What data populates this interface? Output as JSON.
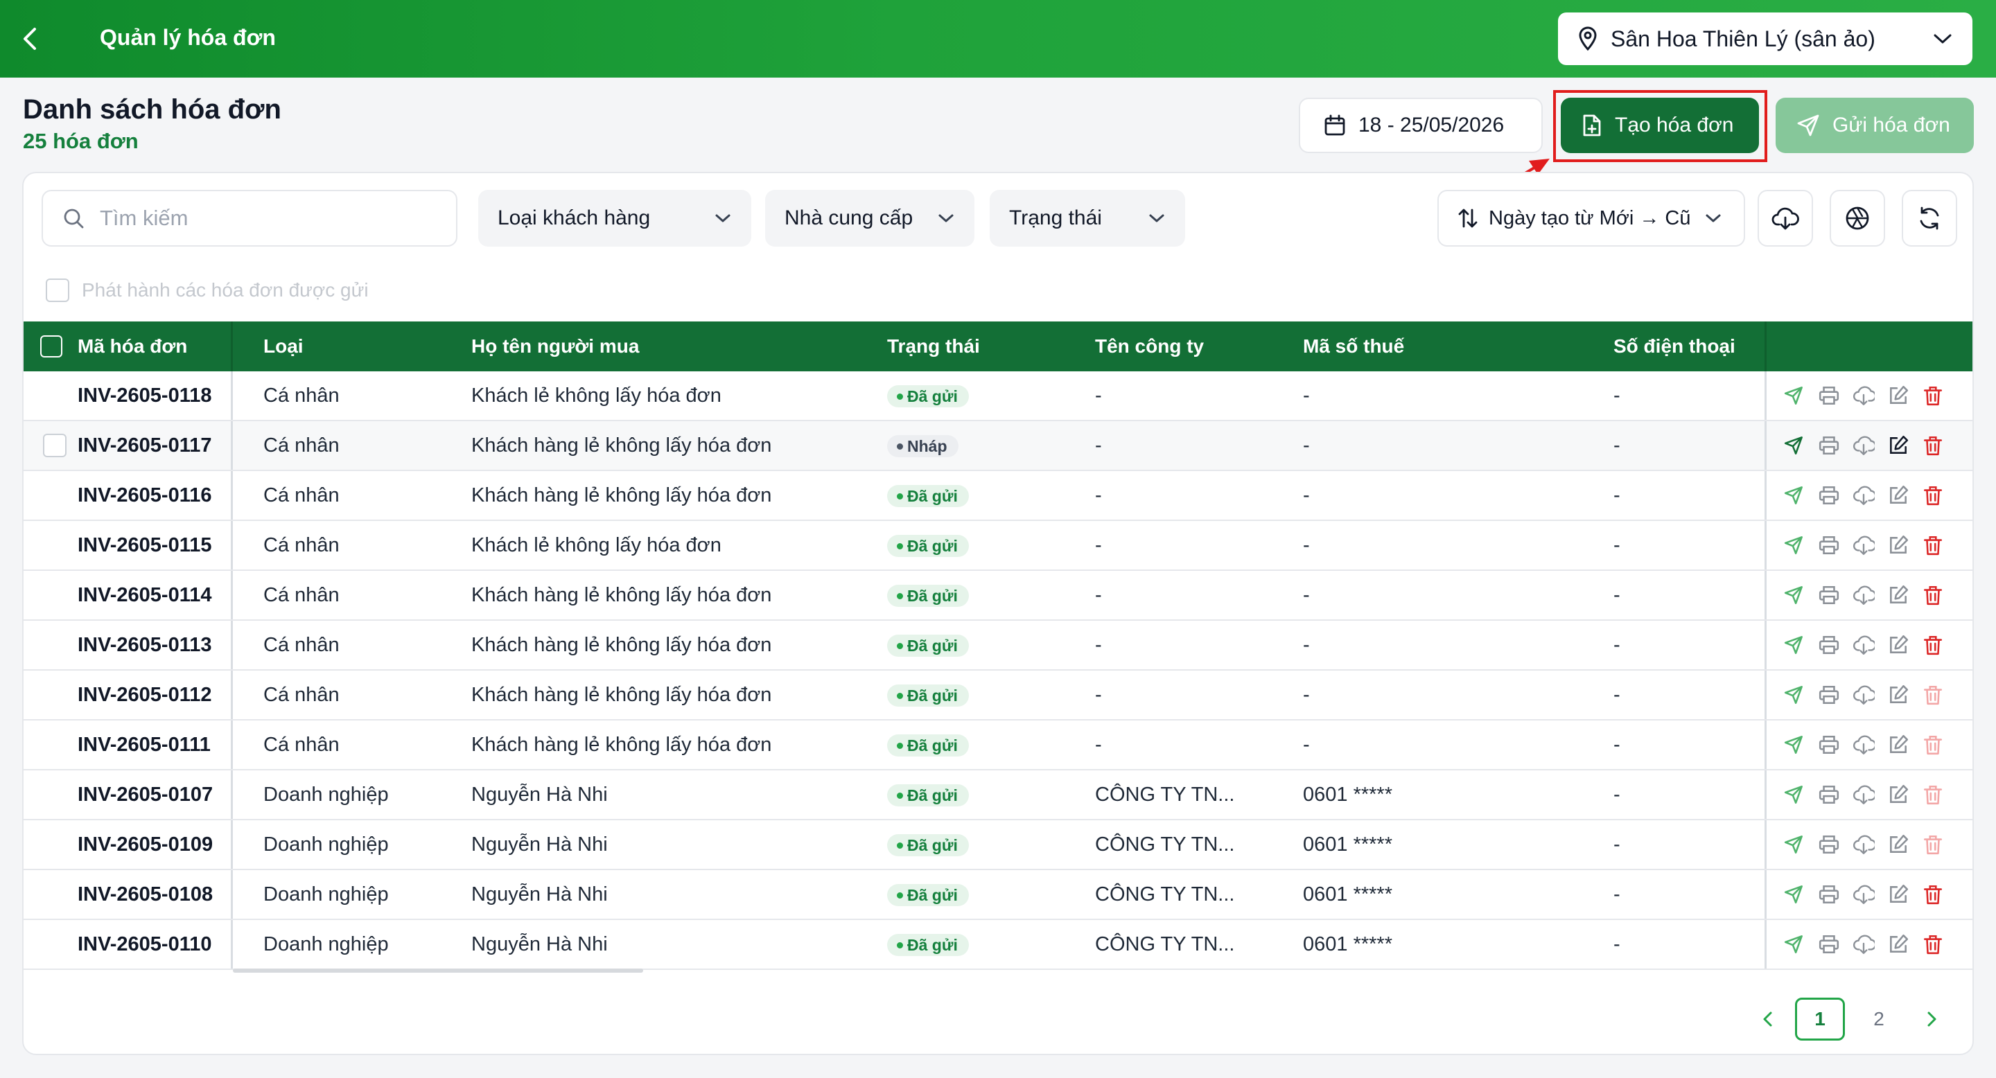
{
  "header": {
    "title": "Quản lý hóa đơn",
    "venue": "Sân Hoa Thiên Lý (sân ảo)"
  },
  "page": {
    "title": "Danh sách hóa đơn",
    "count": "25 hóa đơn"
  },
  "toolbar": {
    "date_range": "18 - 25/05/2026",
    "create_label": "Tạo hóa đơn",
    "send_label": "Gửi hóa đơn"
  },
  "filters": {
    "search_placeholder": "Tìm kiếm",
    "customer_type": "Loại khách hàng",
    "supplier": "Nhà cung cấp",
    "status": "Trạng thái",
    "sort": "Ngày tạo từ Mới → Cũ",
    "publish_label": "Phát hành các hóa đơn được gửi"
  },
  "table": {
    "headers": {
      "code": "Mã hóa đơn",
      "type": "Loại",
      "buyer": "Họ tên người mua",
      "status": "Trạng thái",
      "company": "Tên công ty",
      "tax": "Mã số thuế",
      "phone": "Số điện thoại"
    },
    "rows": [
      {
        "code": "INV-2605-0118",
        "type": "Cá nhân",
        "buyer": "Khách lẻ không lấy hóa đơn",
        "status": "Đã gửi",
        "company": "-",
        "tax": "-",
        "phone": "-"
      },
      {
        "code": "INV-2605-0117",
        "type": "Cá nhân",
        "buyer": "Khách hàng lẻ không lấy hóa đơn",
        "status": "Nháp",
        "company": "-",
        "tax": "-",
        "phone": "-"
      },
      {
        "code": "INV-2605-0116",
        "type": "Cá nhân",
        "buyer": "Khách hàng lẻ không lấy hóa đơn",
        "status": "Đã gửi",
        "company": "-",
        "tax": "-",
        "phone": "-"
      },
      {
        "code": "INV-2605-0115",
        "type": "Cá nhân",
        "buyer": "Khách lẻ không lấy hóa đơn",
        "status": "Đã gửi",
        "company": "-",
        "tax": "-",
        "phone": "-"
      },
      {
        "code": "INV-2605-0114",
        "type": "Cá nhân",
        "buyer": "Khách hàng lẻ không lấy hóa đơn",
        "status": "Đã gửi",
        "company": "-",
        "tax": "-",
        "phone": "-"
      },
      {
        "code": "INV-2605-0113",
        "type": "Cá nhân",
        "buyer": "Khách hàng lẻ không lấy hóa đơn",
        "status": "Đã gửi",
        "company": "-",
        "tax": "-",
        "phone": "-"
      },
      {
        "code": "INV-2605-0112",
        "type": "Cá nhân",
        "buyer": "Khách hàng lẻ không lấy hóa đơn",
        "status": "Đã gửi",
        "company": "-",
        "tax": "-",
        "phone": "-"
      },
      {
        "code": "INV-2605-0111",
        "type": "Cá nhân",
        "buyer": "Khách hàng lẻ không lấy hóa đơn",
        "status": "Đã gửi",
        "company": "-",
        "tax": "-",
        "phone": "-"
      },
      {
        "code": "INV-2605-0107",
        "type": "Doanh nghiệp",
        "buyer": "Nguyễn Hà Nhi",
        "status": "Đã gửi",
        "company": "CÔNG TY TN...",
        "tax": "0601 *****",
        "phone": "-"
      },
      {
        "code": "INV-2605-0109",
        "type": "Doanh nghiệp",
        "buyer": "Nguyễn Hà Nhi",
        "status": "Đã gửi",
        "company": "CÔNG TY TN...",
        "tax": "0601 *****",
        "phone": "-"
      },
      {
        "code": "INV-2605-0108",
        "type": "Doanh nghiệp",
        "buyer": "Nguyễn Hà Nhi",
        "status": "Đã gửi",
        "company": "CÔNG TY TN...",
        "tax": "0601 *****",
        "phone": "-"
      },
      {
        "code": "INV-2605-0110",
        "type": "Doanh nghiệp",
        "buyer": "Nguyễn Hà Nhi",
        "status": "Đã gửi",
        "company": "CÔNG TY TN...",
        "tax": "0601 *****",
        "phone": "-"
      }
    ]
  },
  "pagination": {
    "pages": [
      "1",
      "2"
    ],
    "current": "1"
  },
  "colors": {
    "primary": "#136f36",
    "accent": "#22a548",
    "danger": "#dc2626",
    "annotation": "#e11d1d"
  }
}
